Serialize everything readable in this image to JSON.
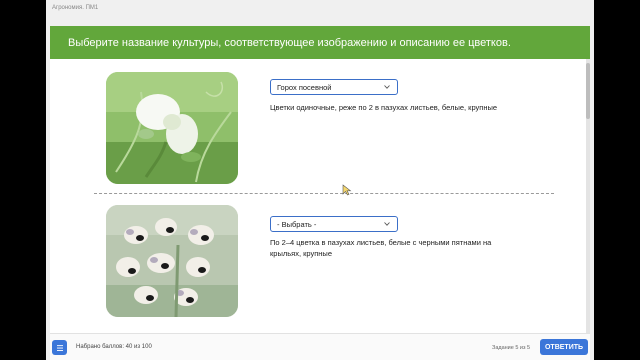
{
  "breadcrumb": "Агрономия. ПМ1",
  "instruction": "Выберите название культуры, соответствующее изображению и описанию ее цветков.",
  "items": [
    {
      "photo_icon": "pea-flower-photo",
      "select_value": "Горох посевной",
      "description": "Цветки одиночные, реже по 2 в пазухах листьев, белые, крупные"
    },
    {
      "photo_icon": "broad-bean-flower-photo",
      "select_value": "- Выбрать -",
      "description": "По 2–4 цветка в пазухах листьев, белые с черными пятнами на крыльях, крупные"
    }
  ],
  "footer": {
    "score_label": "Набрано баллов: 40 из 100",
    "task_label": "Задание 5 из 5",
    "answer_button": "ОТВЕТИТЬ",
    "menu_icon": "list-icon"
  },
  "colors": {
    "banner": "#62a73b",
    "accent": "#3b76d9",
    "select_border": "#3b6fc8"
  }
}
